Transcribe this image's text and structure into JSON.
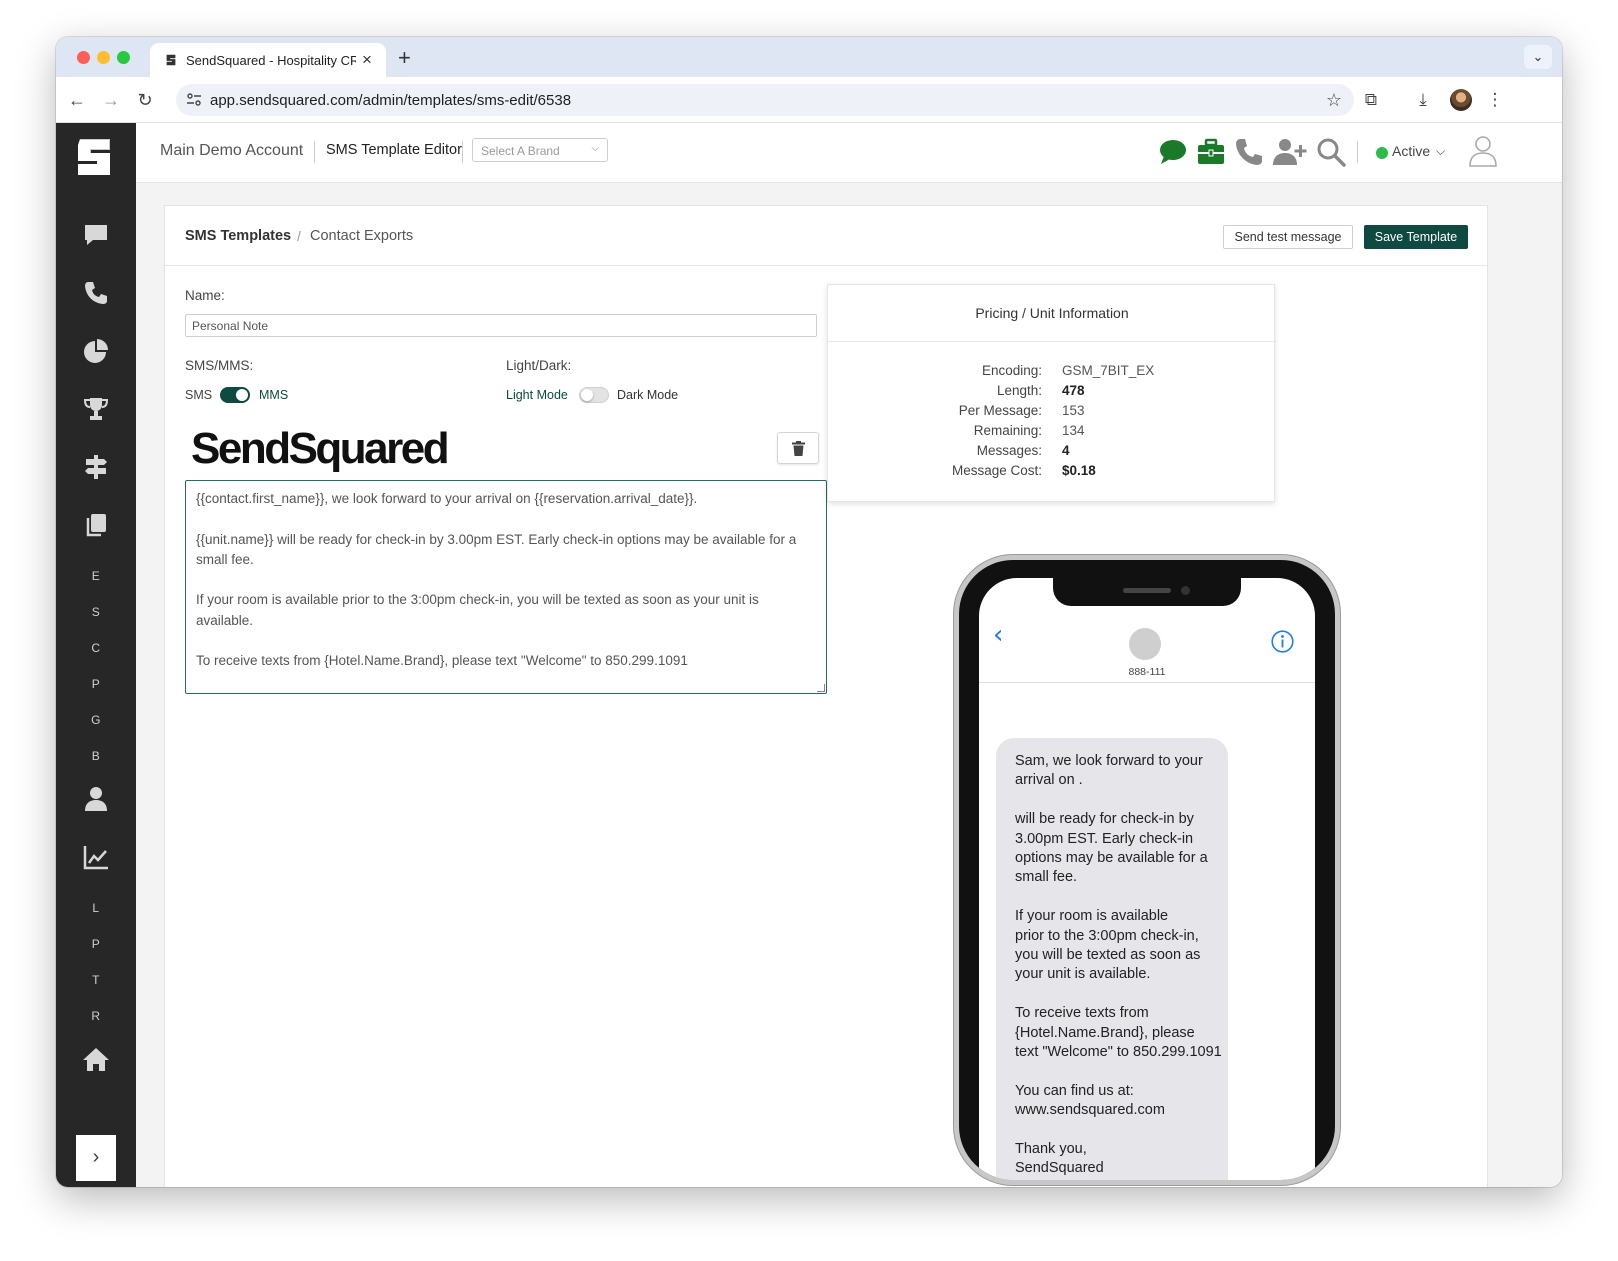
{
  "browser": {
    "tab_title": "SendSquared - Hospitality CRM",
    "url": "app.sendsquared.com/admin/templates/sms-edit/6538"
  },
  "topbar": {
    "account": "Main Demo Account",
    "editor_title": "SMS Template Editor",
    "brand_placeholder": "Select A Brand",
    "status": "Active"
  },
  "sidebar": {
    "letters_top": [
      "E",
      "S",
      "C",
      "P",
      "G",
      "B"
    ],
    "letters_bottom": [
      "L",
      "P",
      "T",
      "R"
    ]
  },
  "breadcrumb": {
    "root": "SMS Templates",
    "separator": "/",
    "current": "Contact Exports"
  },
  "actions": {
    "send_test": "Send test message",
    "save": "Save Template"
  },
  "form": {
    "name_label": "Name:",
    "name_value": "Personal Note",
    "type_label": "SMS/MMS:",
    "type_left": "SMS",
    "type_right": "MMS",
    "type_selected": "MMS",
    "theme_label": "Light/Dark:",
    "theme_left": "Light Mode",
    "theme_right": "Dark Mode",
    "theme_selected": "Light Mode",
    "logo_text": "SendSquared",
    "message_lines": [
      "{{contact.first_name}}, we look forward to your arrival on {{reservation.arrival_date}}.",
      "{{unit.name}} will be ready for check-in by 3.00pm EST. Early check-in options may be available for a small fee.",
      "If your room is available prior to the 3:00pm check-in, you will be texted as soon as your unit is available.",
      "To receive texts from {Hotel.Name.Brand}, please text \"Welcome\" to 850.299.1091"
    ]
  },
  "pricing": {
    "title": "Pricing / Unit Information",
    "rows": [
      {
        "key": "Encoding:",
        "value": "GSM_7BIT_EX",
        "bold": false
      },
      {
        "key": "Length:",
        "value": "478",
        "bold": true
      },
      {
        "key": "Per Message:",
        "value": "153",
        "bold": false
      },
      {
        "key": "Remaining:",
        "value": "134",
        "bold": false
      },
      {
        "key": "Messages:",
        "value": "4",
        "bold": true
      },
      {
        "key": "Message Cost:",
        "value": "$0.18",
        "bold": true
      }
    ]
  },
  "preview": {
    "contact_number": "888-111",
    "paragraphs": [
      "Sam, we look forward to your\narrival on .",
      " will be ready for check-in by\n3.00pm EST. Early check-in\noptions may be available for a\nsmall fee.",
      "If your room is available\nprior to the 3:00pm check-in,\nyou will be texted as soon as\nyour unit is available.",
      "To receive texts from\n{Hotel.Name.Brand}, please\ntext \"Welcome\" to 850.299.1091",
      "You can find us at:\nwww.sendsquared.com",
      "Thank you,\nSendSquared"
    ]
  },
  "colors": {
    "sidebar_bg": "#272727",
    "accent_green": "#0e4a3f",
    "icon_green": "#1a7a2a",
    "status_green": "#2dbb4a",
    "ios_blue": "#1f7ce0"
  }
}
